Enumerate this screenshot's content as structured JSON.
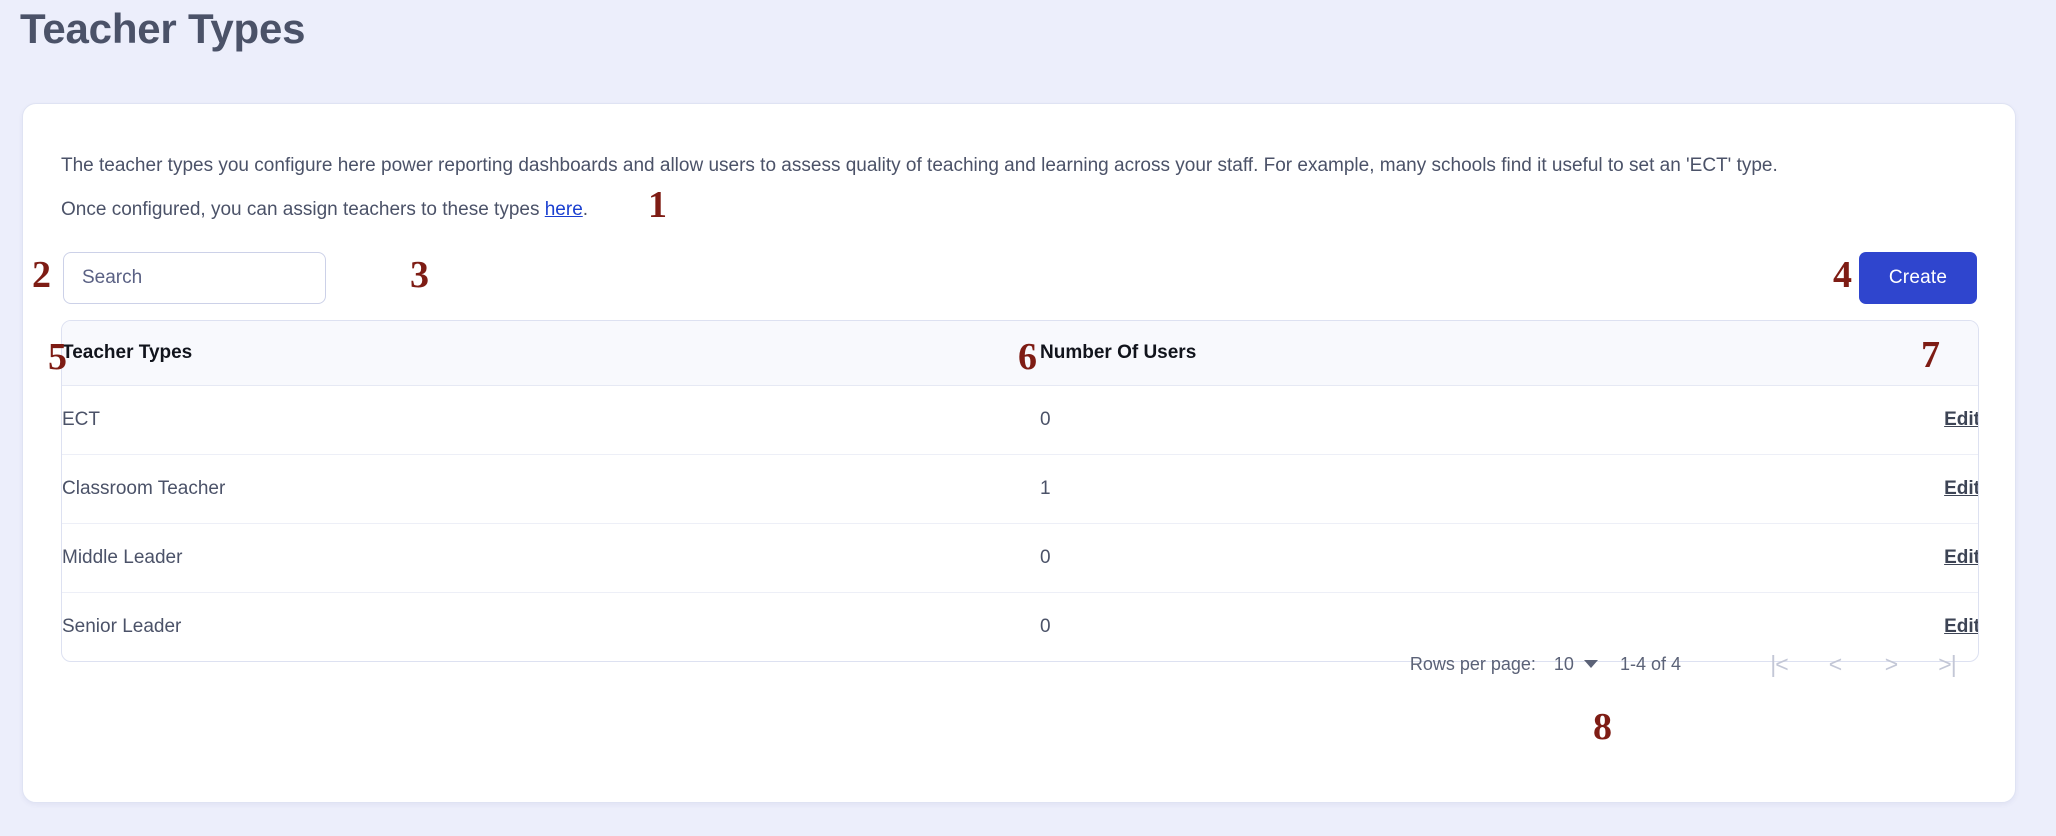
{
  "page": {
    "title": "Teacher Types",
    "background_color": "#eceefb",
    "accent_color": "#2f45ce",
    "marker_color": "#7e1c14"
  },
  "intro": {
    "line1": "The teacher types you configure here power reporting dashboards and allow users to assess quality of teaching and learning across your staff. For example, many schools find it useful to set an 'ECT' type.",
    "line2_before": "Once configured, you can assign teachers to these types ",
    "line2_link": "here",
    "line2_after": "."
  },
  "toolbar": {
    "search_placeholder": "Search",
    "search_value": "",
    "clear_icon": "circle-x-icon",
    "create_label": "Create"
  },
  "table": {
    "headers": {
      "name": "Teacher Types",
      "count": "Number Of Users",
      "action": ""
    },
    "rows": [
      {
        "name": "ECT",
        "count": "0",
        "action": "Edit"
      },
      {
        "name": "Classroom Teacher",
        "count": "1",
        "action": "Edit"
      },
      {
        "name": "Middle Leader",
        "count": "0",
        "action": "Edit"
      },
      {
        "name": "Senior Leader",
        "count": "0",
        "action": "Edit"
      }
    ]
  },
  "paginator": {
    "rows_per_page_label": "Rows per page:",
    "rows_per_page_value": "10",
    "range_label": "1-4 of 4",
    "first_page_icon": "|<",
    "prev_page_icon": "<",
    "next_page_icon": ">",
    "last_page_icon": ">|"
  },
  "markers": {
    "m1": "1",
    "m2": "2",
    "m3": "3",
    "m4": "4",
    "m5": "5",
    "m6": "6",
    "m7": "7",
    "m8": "8"
  }
}
